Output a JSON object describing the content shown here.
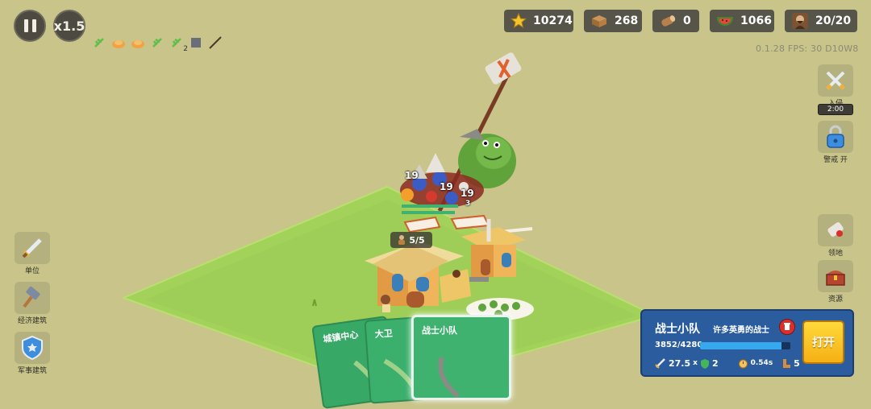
{
  "top_left": {
    "speed_label": "x1.5",
    "status_icons": [
      {
        "icon": "green-leaf-icon",
        "count": ""
      },
      {
        "icon": "orange-bread-icon",
        "count": ""
      },
      {
        "icon": "orange-bread-icon",
        "count": ""
      },
      {
        "icon": "green-leaf-icon",
        "count": ""
      },
      {
        "icon": "green-leaf-icon",
        "count": "2"
      },
      {
        "icon": "stone-block-icon",
        "count": ""
      },
      {
        "icon": "stick-icon",
        "count": ""
      }
    ]
  },
  "resources": {
    "stars": "10274",
    "crates": "268",
    "logs": "0",
    "food": "1066",
    "population": "20/20"
  },
  "version_text": "0.1.28  FPS:  30  D10W8",
  "right_buttons": {
    "invade_label": "入侵",
    "timer": "2:00",
    "alert_label": "警戒 开",
    "territory_label": "领地",
    "resources_label": "资源"
  },
  "left_buttons": {
    "units_label": "单位",
    "economy_label": "经济建筑",
    "military_label": "军事建筑"
  },
  "battle": {
    "damage_numbers": [
      "19",
      "19",
      "19",
      "3"
    ],
    "pop_counter": "5/5"
  },
  "cards": [
    {
      "name": "城镇中心"
    },
    {
      "name": "大卫"
    },
    {
      "name": "战士小队"
    }
  ],
  "info_panel": {
    "title": "战士小队",
    "description": "许多英勇的战士",
    "hp_text": "3852/4280",
    "hp_fraction": 0.9,
    "attack": "27.5",
    "attack_suffix": "x",
    "defense": "2",
    "attack_speed": "0.54s",
    "range": "5",
    "open_label": "打开"
  },
  "colors": {
    "background": "#c8c48a",
    "grass": "#a3d25a",
    "card_green": "#3fb26f",
    "panel_blue": "#2b5c9e",
    "button_yellow": "#f7c22a"
  }
}
